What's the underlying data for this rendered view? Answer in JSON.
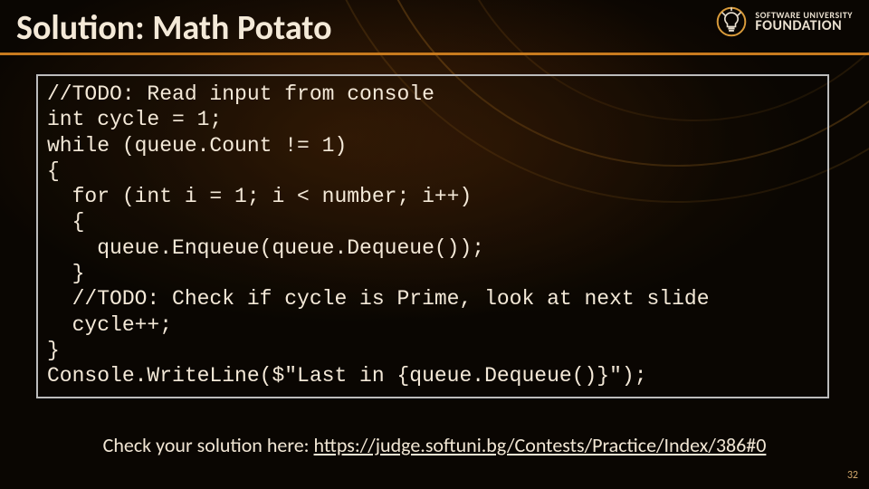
{
  "title": "Solution: Math Potato",
  "logo": {
    "line1": "SOFTWARE UNIVERSITY",
    "line2": "FOUNDATION"
  },
  "code": {
    "l1": "//TODO: Read input from console",
    "l2": "int cycle = 1;",
    "l3": "while (queue.Count != 1)",
    "l4": "{",
    "l5": "  for (int i = 1; i < number; i++)",
    "l6": "  {",
    "l7": "    queue.Enqueue(queue.Dequeue());",
    "l8": "  }",
    "l9": "  //TODO: Check if cycle is Prime, look at next slide",
    "l10": "  cycle++;",
    "l11": "}",
    "l12": "Console.WriteLine($\"Last in {queue.Dequeue()}\");"
  },
  "caption": {
    "prefix": "Check your solution here: ",
    "link": "https://judge.softuni.bg/Contests/Practice/Index/386#0"
  },
  "page_number": "32"
}
